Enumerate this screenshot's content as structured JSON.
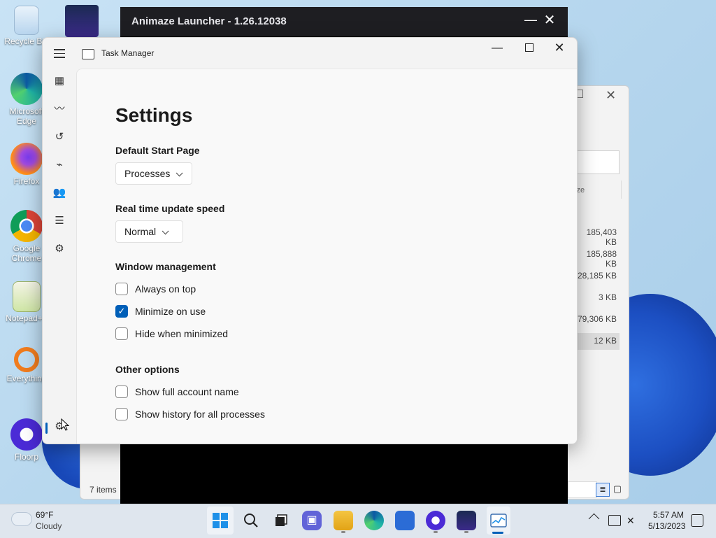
{
  "desktop": {
    "icons": [
      {
        "label": "Recycle Bin",
        "icon": "recycle-bin-icon"
      },
      {
        "label": "Microsoft Edge",
        "icon": "edge-icon"
      },
      {
        "label": "Firefox",
        "icon": "firefox-icon"
      },
      {
        "label": "Google Chrome",
        "icon": "chrome-icon"
      },
      {
        "label": "Notepad++",
        "icon": "notepadpp-icon"
      },
      {
        "label": "Everything",
        "icon": "everything-icon"
      },
      {
        "label": "Floorp",
        "icon": "floorp-icon"
      }
    ]
  },
  "animaze": {
    "title": "Animaze Launcher - 1.26.12038",
    "min_glyph": "—",
    "close_glyph": "✕"
  },
  "explorer": {
    "column_header": "ize",
    "sizes": [
      "185,403 KB",
      "185,888 KB",
      "28,185 KB",
      "3 KB",
      "79,306 KB",
      "12 KB"
    ],
    "status": "7 items",
    "close_glyph": "✕"
  },
  "task_manager": {
    "title": "Task Manager",
    "min_glyph": "—",
    "close_glyph": "✕",
    "nav": [
      {
        "name": "processes",
        "glyph": "▦"
      },
      {
        "name": "performance",
        "glyph": "〰"
      },
      {
        "name": "app-history",
        "glyph": "↺"
      },
      {
        "name": "startup-apps",
        "glyph": "⌁"
      },
      {
        "name": "users",
        "glyph": "👥"
      },
      {
        "name": "details",
        "glyph": "☰"
      },
      {
        "name": "services",
        "glyph": "⚙"
      }
    ],
    "settings_glyph": "⚙",
    "settings": {
      "heading": "Settings",
      "default_start_page": {
        "label": "Default Start Page",
        "value": "Processes"
      },
      "update_speed": {
        "label": "Real time update speed",
        "value": "Normal"
      },
      "window_management": {
        "label": "Window management",
        "options": [
          {
            "label": "Always on top",
            "checked": false
          },
          {
            "label": "Minimize on use",
            "checked": true
          },
          {
            "label": "Hide when minimized",
            "checked": false
          }
        ]
      },
      "other_options": {
        "label": "Other options",
        "options": [
          {
            "label": "Show full account name",
            "checked": false
          },
          {
            "label": "Show history for all processes",
            "checked": false
          }
        ]
      }
    }
  },
  "taskbar": {
    "weather": {
      "temp": "69°F",
      "condition": "Cloudy"
    },
    "time": "5:57 AM",
    "date": "5/13/2023",
    "accent": "#005fb8"
  }
}
